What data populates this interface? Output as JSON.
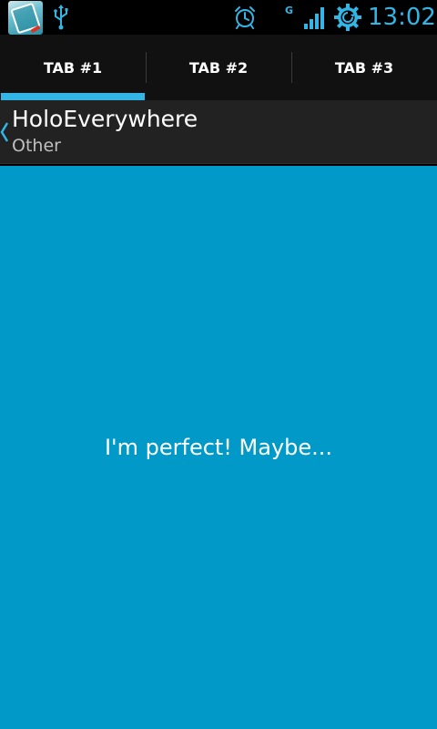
{
  "status_bar": {
    "time": "13:02",
    "network_type": "G",
    "icons": [
      "app-notification-icon",
      "usb-icon",
      "alarm-icon",
      "signal-icon",
      "sync-icon"
    ],
    "accent_color": "#33b5e5"
  },
  "tabs": [
    {
      "label": "TAB #1",
      "selected": true
    },
    {
      "label": "TAB #2",
      "selected": false
    },
    {
      "label": "TAB #3",
      "selected": false
    }
  ],
  "action_bar": {
    "title": "HoloEverywhere",
    "subtitle": "Other"
  },
  "content": {
    "message": "I'm perfect! Maybe...",
    "background_color": "#0099c8"
  }
}
